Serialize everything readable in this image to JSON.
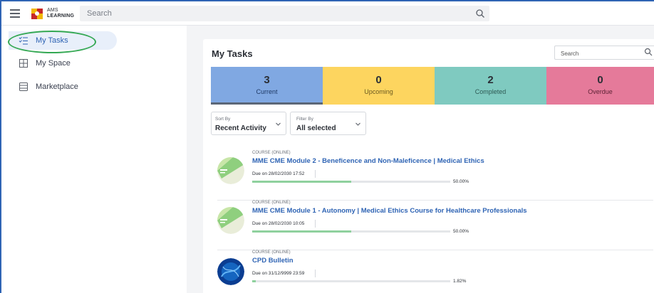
{
  "topbar": {
    "logo_line1": "AMS",
    "logo_line2": "LEARNING",
    "search_placeholder": "Search"
  },
  "sidebar": {
    "items": [
      {
        "label": "My Tasks",
        "icon": "task-list-icon",
        "active": true
      },
      {
        "label": "My Space",
        "icon": "grid-icon",
        "active": false
      },
      {
        "label": "Marketplace",
        "icon": "catalog-icon",
        "active": false
      }
    ]
  },
  "main": {
    "title": "My Tasks",
    "search_placeholder": "Search",
    "tiles": [
      {
        "count": "3",
        "label": "Current"
      },
      {
        "count": "0",
        "label": "Upcoming"
      },
      {
        "count": "2",
        "label": "Completed"
      },
      {
        "count": "0",
        "label": "Overdue"
      }
    ],
    "sort": {
      "caption": "Sort By",
      "value": "Recent Activity"
    },
    "filter": {
      "caption": "Filter By",
      "value": "All selected"
    },
    "tasks": [
      {
        "type": "COURSE (ONLINE)",
        "title": "MME CME Module 2 - Beneficence and Non-Maleficence | Medical Ethics",
        "due": "Due on 28/02/2030 17:52",
        "progress_pct": 50.0,
        "progress_label": "50.00%"
      },
      {
        "type": "COURSE (ONLINE)",
        "title": "MME CME Module 1 - Autonomy | Medical Ethics Course for Healthcare Professionals",
        "due": "Due on 28/02/2030 10:05",
        "progress_pct": 50.0,
        "progress_label": "50.00%"
      },
      {
        "type": "COURSE (ONLINE)",
        "title": "CPD Bulletin",
        "due": "Due on 31/12/9999 23:59",
        "progress_pct": 1.82,
        "progress_label": "1.82%"
      }
    ]
  },
  "colors": {
    "accent": "#2f64b4",
    "current_tile": "#80a8e2",
    "upcoming_tile": "#fdd55f",
    "completed_tile": "#7fcac0",
    "overdue_tile": "#e57a9a",
    "progress_fill": "#8fd19e",
    "annotation_circle": "#34a853"
  }
}
